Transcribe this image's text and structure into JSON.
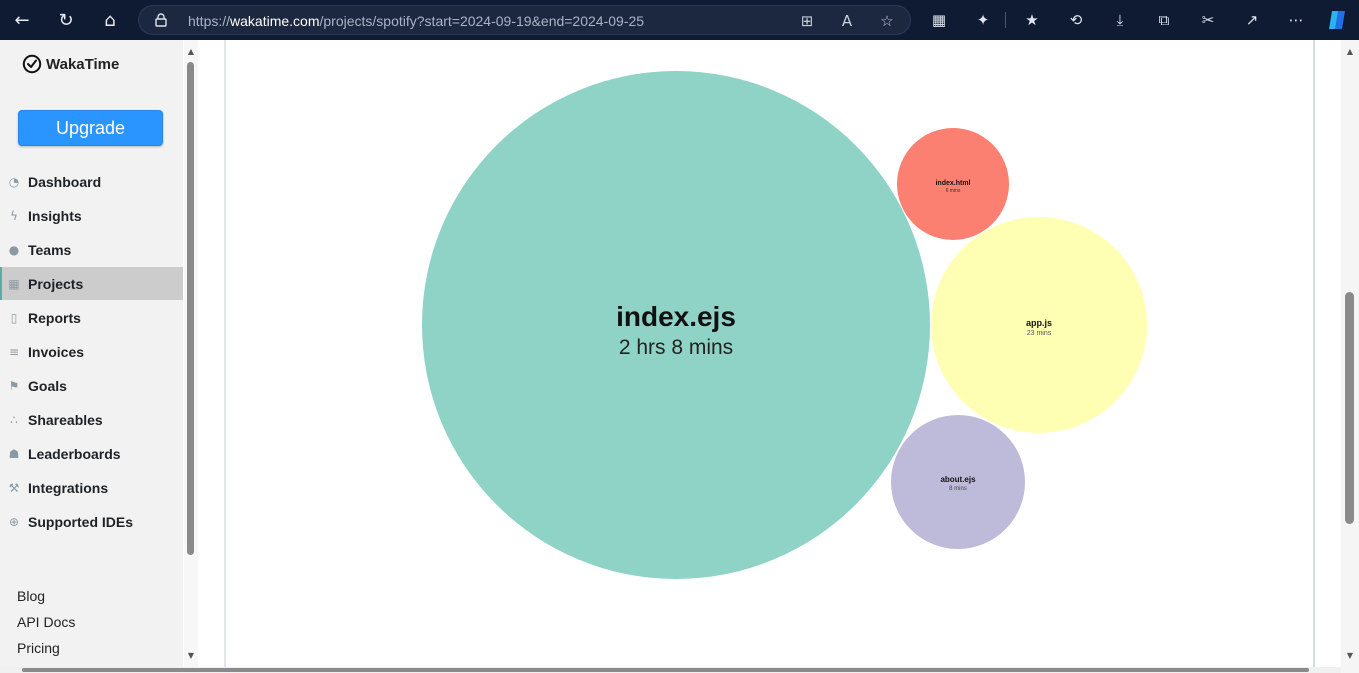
{
  "browser": {
    "url_prefix": "https://",
    "url_host": "wakatime.com",
    "url_path": "/projects/spotify?start=2024-09-19&end=2024-09-25"
  },
  "sidebar": {
    "brand": "WakaTime",
    "upgrade_label": "Upgrade",
    "items": [
      {
        "label": "Dashboard",
        "icon": "dashboard-icon"
      },
      {
        "label": "Insights",
        "icon": "bolt-icon"
      },
      {
        "label": "Teams",
        "icon": "users-icon"
      },
      {
        "label": "Projects",
        "icon": "grid-icon",
        "active": true
      },
      {
        "label": "Reports",
        "icon": "file-pdf-icon"
      },
      {
        "label": "Invoices",
        "icon": "file-text-icon"
      },
      {
        "label": "Goals",
        "icon": "flag-icon"
      },
      {
        "label": "Shareables",
        "icon": "share-icon"
      },
      {
        "label": "Leaderboards",
        "icon": "trophy-icon"
      },
      {
        "label": "Integrations",
        "icon": "wrench-icon"
      },
      {
        "label": "Supported IDEs",
        "icon": "plus-circle-icon"
      }
    ],
    "footer_links": [
      "Blog",
      "API Docs",
      "Pricing"
    ]
  },
  "files_chart": {
    "type": "bubble",
    "files": [
      {
        "name": "index.ejs",
        "time": "2 hrs 8 mins",
        "color": "#8fd3c7"
      },
      {
        "name": "index.html",
        "time": "6 mins",
        "color": "#fb8072"
      },
      {
        "name": "app.js",
        "time": "23 mins",
        "color": "#ffffb3"
      },
      {
        "name": "about.ejs",
        "time": "8 mins",
        "color": "#bebada"
      }
    ]
  }
}
